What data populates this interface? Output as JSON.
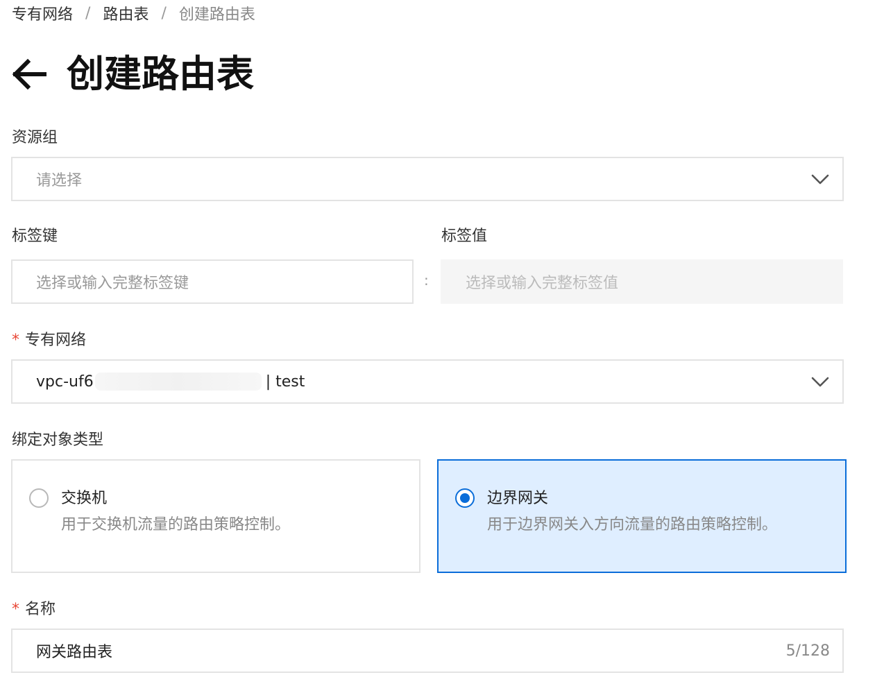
{
  "breadcrumb": {
    "items": [
      "专有网络",
      "路由表",
      "创建路由表"
    ],
    "separator": "/"
  },
  "header": {
    "title": "创建路由表",
    "back_icon": "arrow-left-icon"
  },
  "resource_group": {
    "label": "资源组",
    "placeholder": "请选择"
  },
  "tag_key": {
    "label": "标签键",
    "placeholder": "选择或输入完整标签键"
  },
  "tag_separator": ":",
  "tag_value": {
    "label": "标签值",
    "placeholder": "选择或输入完整标签值"
  },
  "vpc": {
    "required_mark": "*",
    "label": "专有网络",
    "value_prefix": "vpc-uf6",
    "value_suffix": "| test"
  },
  "bind_type": {
    "label": "绑定对象类型",
    "options": [
      {
        "title": "交换机",
        "description": "用于交换机流量的路由策略控制。",
        "selected": false
      },
      {
        "title": "边界网关",
        "description": "用于边界网关入方向流量的路由策略控制。",
        "selected": true
      }
    ]
  },
  "name": {
    "required_mark": "*",
    "label": "名称",
    "value": "网关路由表",
    "counter": "5/128"
  },
  "colors": {
    "accent": "#0a6dd9",
    "selected_bg": "#dfeeff",
    "required": "#e84736",
    "border": "#e3e3e3"
  }
}
